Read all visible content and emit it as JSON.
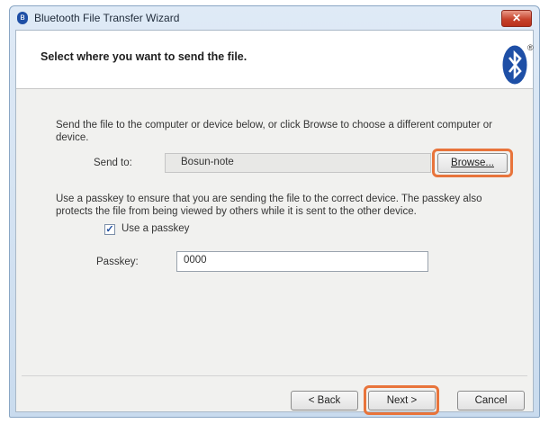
{
  "window": {
    "title": "Bluetooth File Transfer Wizard",
    "close_glyph": "✕",
    "title_icon_glyph": "ʙ"
  },
  "header": {
    "title": "Select where you want to send the file.",
    "logo_icon": "bluetooth-icon",
    "reg_mark": "®"
  },
  "send_section": {
    "instruction": "Send the file to the computer or device below, or click Browse to choose a different computer or device.",
    "send_to_label": "Send to:",
    "send_to_value": "Bosun-note",
    "browse_button": "Browse..."
  },
  "passkey_section": {
    "instruction": "Use a passkey to ensure that you are sending the file to the correct device. The passkey also protects the file from being viewed by others while it is sent to the other device.",
    "use_passkey_label": "Use a passkey",
    "use_passkey_checked": true,
    "check_glyph": "✓",
    "passkey_label": "Passkey:",
    "passkey_value": "0000"
  },
  "footer": {
    "back_button": "< Back",
    "next_button": "Next >",
    "cancel_button": "Cancel"
  },
  "colors": {
    "highlight": "#e8743b",
    "bluetooth_blue": "#1e4fa6"
  }
}
